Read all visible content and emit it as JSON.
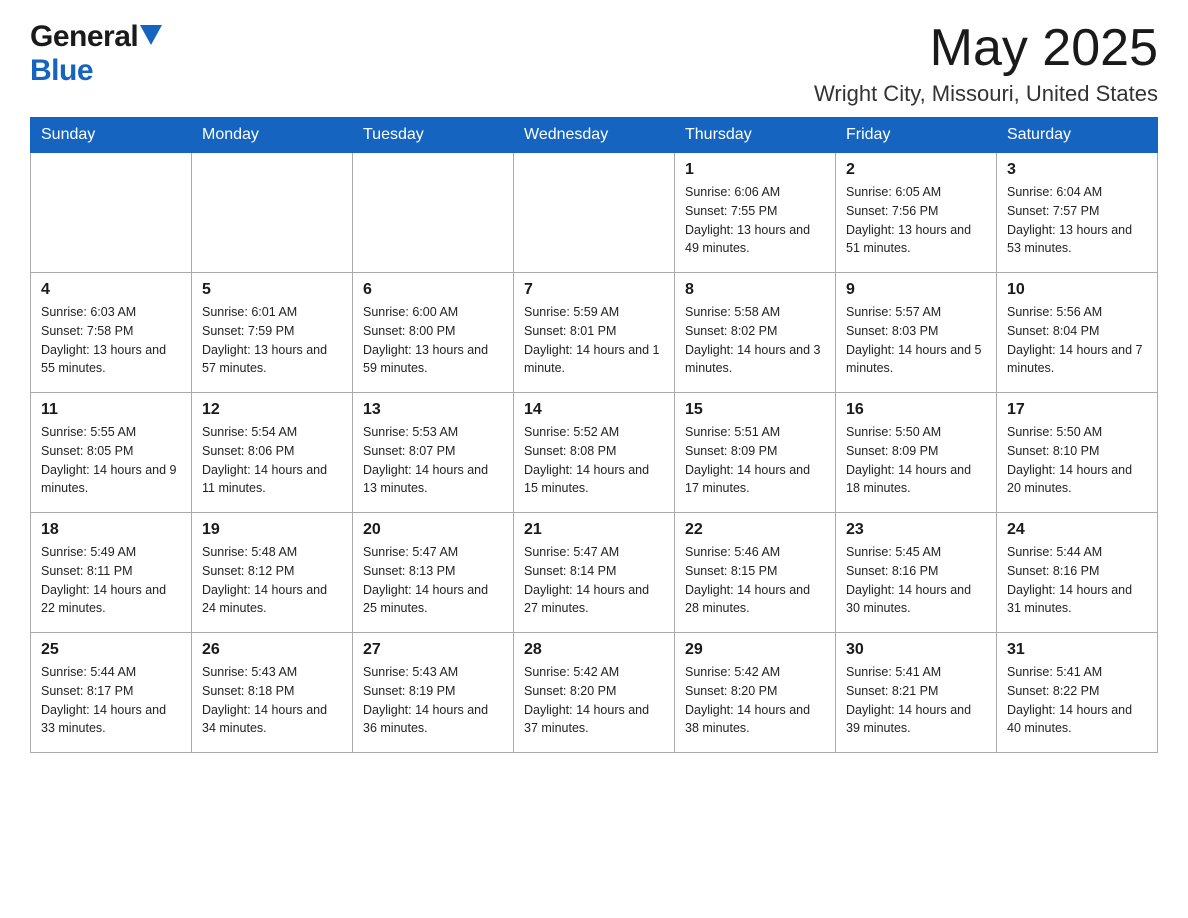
{
  "header": {
    "logo_general": "General",
    "logo_blue": "Blue",
    "month_title": "May 2025",
    "location": "Wright City, Missouri, United States"
  },
  "days_of_week": [
    "Sunday",
    "Monday",
    "Tuesday",
    "Wednesday",
    "Thursday",
    "Friday",
    "Saturday"
  ],
  "weeks": [
    {
      "days": [
        {
          "number": "",
          "sunrise": "",
          "sunset": "",
          "daylight": ""
        },
        {
          "number": "",
          "sunrise": "",
          "sunset": "",
          "daylight": ""
        },
        {
          "number": "",
          "sunrise": "",
          "sunset": "",
          "daylight": ""
        },
        {
          "number": "",
          "sunrise": "",
          "sunset": "",
          "daylight": ""
        },
        {
          "number": "1",
          "sunrise": "Sunrise: 6:06 AM",
          "sunset": "Sunset: 7:55 PM",
          "daylight": "Daylight: 13 hours and 49 minutes."
        },
        {
          "number": "2",
          "sunrise": "Sunrise: 6:05 AM",
          "sunset": "Sunset: 7:56 PM",
          "daylight": "Daylight: 13 hours and 51 minutes."
        },
        {
          "number": "3",
          "sunrise": "Sunrise: 6:04 AM",
          "sunset": "Sunset: 7:57 PM",
          "daylight": "Daylight: 13 hours and 53 minutes."
        }
      ]
    },
    {
      "days": [
        {
          "number": "4",
          "sunrise": "Sunrise: 6:03 AM",
          "sunset": "Sunset: 7:58 PM",
          "daylight": "Daylight: 13 hours and 55 minutes."
        },
        {
          "number": "5",
          "sunrise": "Sunrise: 6:01 AM",
          "sunset": "Sunset: 7:59 PM",
          "daylight": "Daylight: 13 hours and 57 minutes."
        },
        {
          "number": "6",
          "sunrise": "Sunrise: 6:00 AM",
          "sunset": "Sunset: 8:00 PM",
          "daylight": "Daylight: 13 hours and 59 minutes."
        },
        {
          "number": "7",
          "sunrise": "Sunrise: 5:59 AM",
          "sunset": "Sunset: 8:01 PM",
          "daylight": "Daylight: 14 hours and 1 minute."
        },
        {
          "number": "8",
          "sunrise": "Sunrise: 5:58 AM",
          "sunset": "Sunset: 8:02 PM",
          "daylight": "Daylight: 14 hours and 3 minutes."
        },
        {
          "number": "9",
          "sunrise": "Sunrise: 5:57 AM",
          "sunset": "Sunset: 8:03 PM",
          "daylight": "Daylight: 14 hours and 5 minutes."
        },
        {
          "number": "10",
          "sunrise": "Sunrise: 5:56 AM",
          "sunset": "Sunset: 8:04 PM",
          "daylight": "Daylight: 14 hours and 7 minutes."
        }
      ]
    },
    {
      "days": [
        {
          "number": "11",
          "sunrise": "Sunrise: 5:55 AM",
          "sunset": "Sunset: 8:05 PM",
          "daylight": "Daylight: 14 hours and 9 minutes."
        },
        {
          "number": "12",
          "sunrise": "Sunrise: 5:54 AM",
          "sunset": "Sunset: 8:06 PM",
          "daylight": "Daylight: 14 hours and 11 minutes."
        },
        {
          "number": "13",
          "sunrise": "Sunrise: 5:53 AM",
          "sunset": "Sunset: 8:07 PM",
          "daylight": "Daylight: 14 hours and 13 minutes."
        },
        {
          "number": "14",
          "sunrise": "Sunrise: 5:52 AM",
          "sunset": "Sunset: 8:08 PM",
          "daylight": "Daylight: 14 hours and 15 minutes."
        },
        {
          "number": "15",
          "sunrise": "Sunrise: 5:51 AM",
          "sunset": "Sunset: 8:09 PM",
          "daylight": "Daylight: 14 hours and 17 minutes."
        },
        {
          "number": "16",
          "sunrise": "Sunrise: 5:50 AM",
          "sunset": "Sunset: 8:09 PM",
          "daylight": "Daylight: 14 hours and 18 minutes."
        },
        {
          "number": "17",
          "sunrise": "Sunrise: 5:50 AM",
          "sunset": "Sunset: 8:10 PM",
          "daylight": "Daylight: 14 hours and 20 minutes."
        }
      ]
    },
    {
      "days": [
        {
          "number": "18",
          "sunrise": "Sunrise: 5:49 AM",
          "sunset": "Sunset: 8:11 PM",
          "daylight": "Daylight: 14 hours and 22 minutes."
        },
        {
          "number": "19",
          "sunrise": "Sunrise: 5:48 AM",
          "sunset": "Sunset: 8:12 PM",
          "daylight": "Daylight: 14 hours and 24 minutes."
        },
        {
          "number": "20",
          "sunrise": "Sunrise: 5:47 AM",
          "sunset": "Sunset: 8:13 PM",
          "daylight": "Daylight: 14 hours and 25 minutes."
        },
        {
          "number": "21",
          "sunrise": "Sunrise: 5:47 AM",
          "sunset": "Sunset: 8:14 PM",
          "daylight": "Daylight: 14 hours and 27 minutes."
        },
        {
          "number": "22",
          "sunrise": "Sunrise: 5:46 AM",
          "sunset": "Sunset: 8:15 PM",
          "daylight": "Daylight: 14 hours and 28 minutes."
        },
        {
          "number": "23",
          "sunrise": "Sunrise: 5:45 AM",
          "sunset": "Sunset: 8:16 PM",
          "daylight": "Daylight: 14 hours and 30 minutes."
        },
        {
          "number": "24",
          "sunrise": "Sunrise: 5:44 AM",
          "sunset": "Sunset: 8:16 PM",
          "daylight": "Daylight: 14 hours and 31 minutes."
        }
      ]
    },
    {
      "days": [
        {
          "number": "25",
          "sunrise": "Sunrise: 5:44 AM",
          "sunset": "Sunset: 8:17 PM",
          "daylight": "Daylight: 14 hours and 33 minutes."
        },
        {
          "number": "26",
          "sunrise": "Sunrise: 5:43 AM",
          "sunset": "Sunset: 8:18 PM",
          "daylight": "Daylight: 14 hours and 34 minutes."
        },
        {
          "number": "27",
          "sunrise": "Sunrise: 5:43 AM",
          "sunset": "Sunset: 8:19 PM",
          "daylight": "Daylight: 14 hours and 36 minutes."
        },
        {
          "number": "28",
          "sunrise": "Sunrise: 5:42 AM",
          "sunset": "Sunset: 8:20 PM",
          "daylight": "Daylight: 14 hours and 37 minutes."
        },
        {
          "number": "29",
          "sunrise": "Sunrise: 5:42 AM",
          "sunset": "Sunset: 8:20 PM",
          "daylight": "Daylight: 14 hours and 38 minutes."
        },
        {
          "number": "30",
          "sunrise": "Sunrise: 5:41 AM",
          "sunset": "Sunset: 8:21 PM",
          "daylight": "Daylight: 14 hours and 39 minutes."
        },
        {
          "number": "31",
          "sunrise": "Sunrise: 5:41 AM",
          "sunset": "Sunset: 8:22 PM",
          "daylight": "Daylight: 14 hours and 40 minutes."
        }
      ]
    }
  ]
}
